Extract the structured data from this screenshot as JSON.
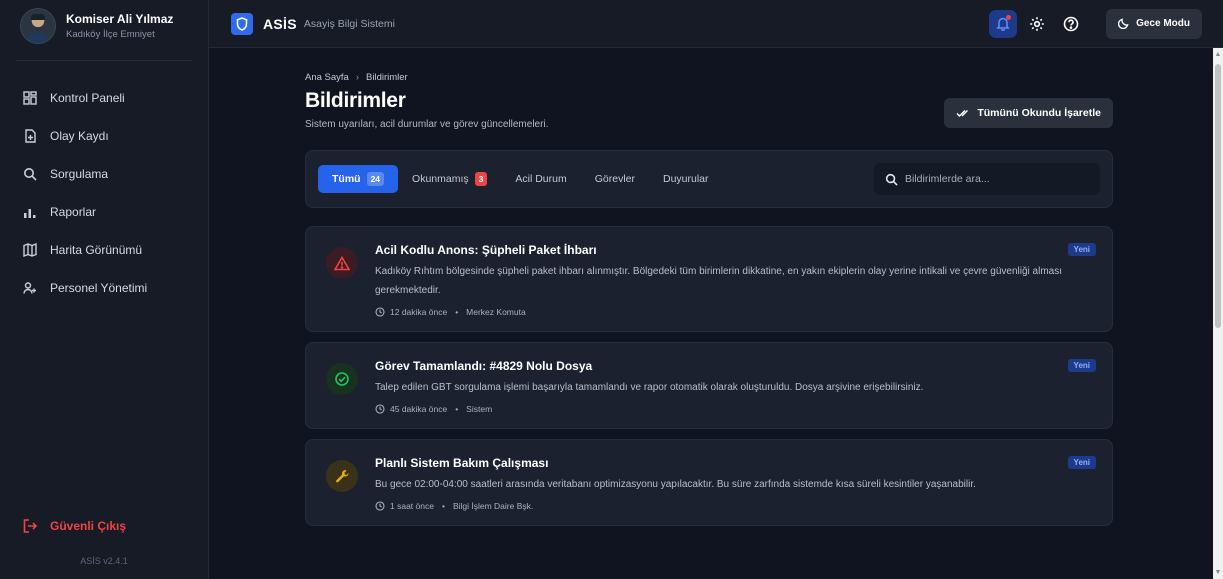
{
  "user": {
    "name": "Komiser Ali Yılmaz",
    "unit": "Kadıköy İlçe Emniyet"
  },
  "sidebar": {
    "items": [
      {
        "label": "Kontrol Paneli",
        "icon": "dashboard-icon"
      },
      {
        "label": "Olay Kaydı",
        "icon": "file-plus-icon"
      },
      {
        "label": "Sorgulama",
        "icon": "search-icon"
      },
      {
        "label": "Raporlar",
        "icon": "bar-chart-icon"
      },
      {
        "label": "Harita Görünümü",
        "icon": "map-icon"
      },
      {
        "label": "Personel Yönetimi",
        "icon": "users-icon"
      }
    ],
    "logout_label": "Güvenli Çıkış",
    "version": "ASİS v2.4.1"
  },
  "topbar": {
    "brand": "ASİS",
    "brand_sub": "Asayiş Bilgi Sistemi",
    "night_mode_label": "Gece Modu"
  },
  "page": {
    "breadcrumb": [
      "Ana Sayfa",
      "Bildirimler"
    ],
    "breadcrumb_sep": "›",
    "title": "Bildirimler",
    "subtitle": "Sistem uyarıları, acil durumlar ve görev güncellemeleri.",
    "mark_all_label": "Tümünü Okundu İşaretle"
  },
  "filters": {
    "tabs": [
      {
        "label": "Tümü",
        "count": "24"
      },
      {
        "label": "Okunmamış",
        "count": "3"
      },
      {
        "label": "Acil Durum"
      },
      {
        "label": "Görevler"
      },
      {
        "label": "Duyurular"
      }
    ],
    "search_placeholder": "Bildirimlerde ara..."
  },
  "notifications": [
    {
      "title": "Acil Kodlu Anons: Şüpheli Paket İhbarı",
      "text": "Kadıköy Rıhtım bölgesinde şüpheli paket ihbarı alınmıştır. Bölgedeki tüm birimlerin dikkatine, en yakın ekiplerin olay yerine intikali ve çevre güvenliği alması gerekmektedir.",
      "time": "12 dakika önce",
      "source": "Merkez Komuta",
      "badge": "Yeni",
      "icon": "alert-triangle-icon",
      "color": "#ef4444"
    },
    {
      "title": "Görev Tamamlandı: #4829 Nolu Dosya",
      "text": "Talep edilen GBT sorgulama işlemi başarıyla tamamlandı ve rapor otomatik olarak oluşturuldu. Dosya arşivine erişebilirsiniz.",
      "time": "45 dakika önce",
      "source": "Sistem",
      "badge": "Yeni",
      "icon": "check-circle-icon",
      "color": "#22c55e"
    },
    {
      "title": "Planlı Sistem Bakım Çalışması",
      "text": "Bu gece 02:00-04:00 saatleri arasında veritabanı optimizasyonu yapılacaktır. Bu süre zarfında sistemde kısa süreli kesintiler yaşanabilir.",
      "time": "1 saat önce",
      "source": "Bilgi İşlem Daire Bşk.",
      "badge": "Yeni",
      "icon": "wrench-icon",
      "color": "#eab308"
    }
  ],
  "colors": {
    "accent": "#2563eb",
    "danger": "#ef4444",
    "success": "#22c55e",
    "warning": "#eab308"
  }
}
